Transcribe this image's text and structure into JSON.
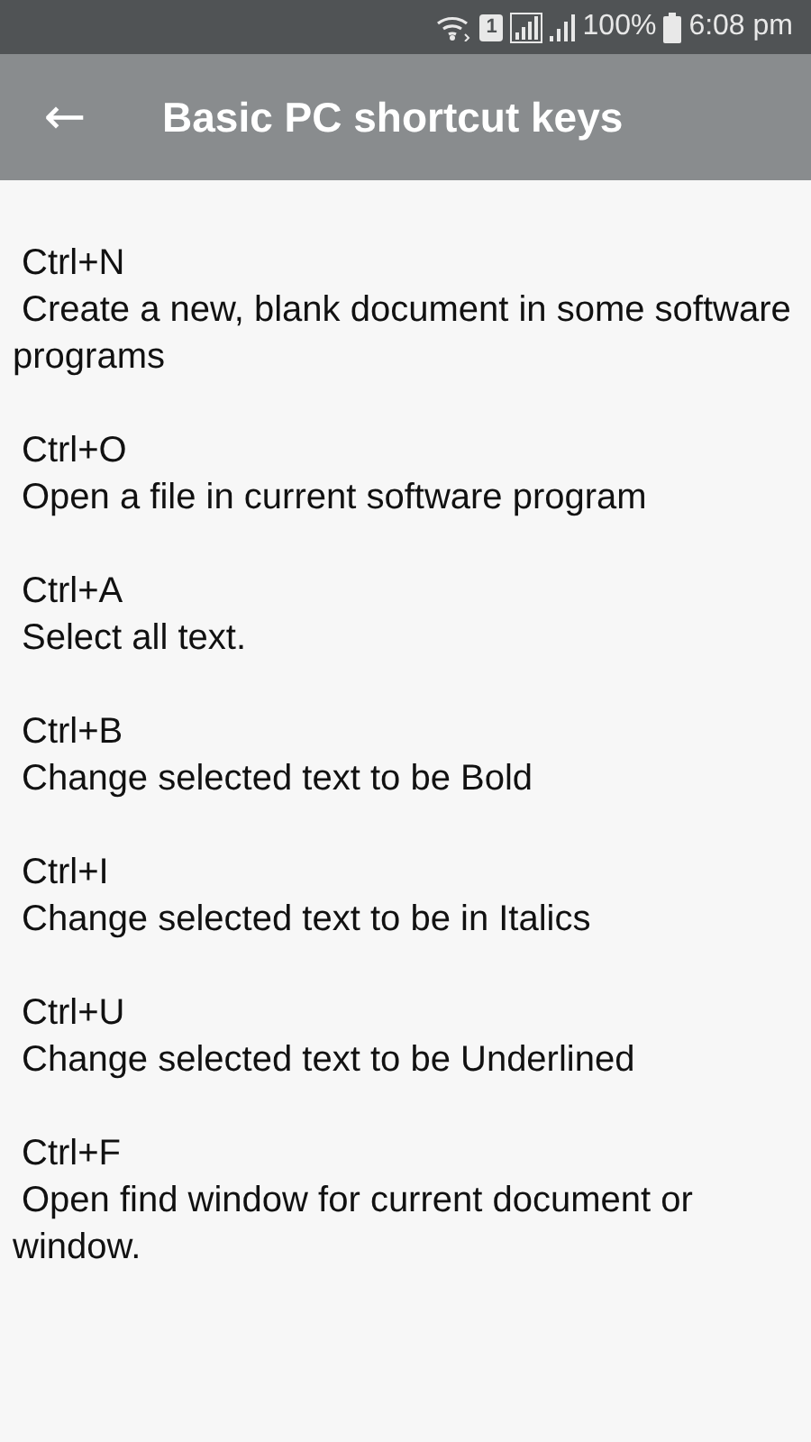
{
  "status_bar": {
    "sim_badge": "1",
    "battery": "100%",
    "time": "6:08 pm"
  },
  "app_bar": {
    "back": "←",
    "title": "Basic PC shortcut keys"
  },
  "shortcuts": [
    {
      "key": "Ctrl+N",
      "description": "Create a new, blank document in some software programs"
    },
    {
      "key": "Ctrl+O",
      "description": "Open a file in current software program"
    },
    {
      "key": "Ctrl+A",
      "description": "Select all text."
    },
    {
      "key": "Ctrl+B",
      "description": "Change selected text to be Bold"
    },
    {
      "key": "Ctrl+I",
      "description": "Change selected text to be in Italics"
    },
    {
      "key": "Ctrl+U",
      "description": "Change selected text to be Underlined"
    },
    {
      "key": "Ctrl+F",
      "description": "Open find window for current document or window."
    }
  ]
}
